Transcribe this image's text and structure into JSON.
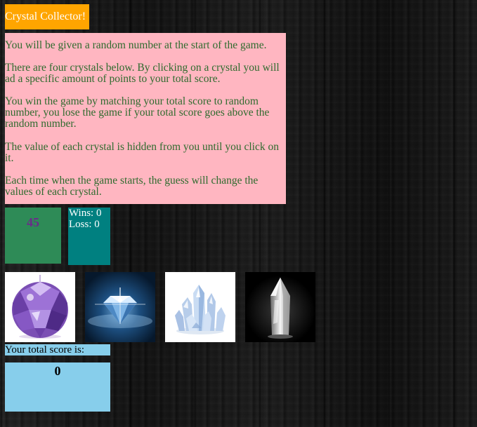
{
  "title": "Crystal Collector!",
  "instructions": [
    "You will be given a random number at the start of the game.",
    "There are four crystals below. By clicking on a crystal you will ad a specific amount of points to your total score.",
    "You win the game by matching your total score to random number, you lose the game if your total score goes above the random number.",
    "The value of each crystal is hidden from you until you click on it.",
    "Each time when the game starts, the guess will change the values of each crystal."
  ],
  "random_number": "45",
  "stats": {
    "wins": "Wins: 0",
    "losses": "Loss: 0"
  },
  "crystals": [
    {
      "icon": "purple-faceted-crystal-icon"
    },
    {
      "icon": "blue-diamond-icon"
    },
    {
      "icon": "blue-crystal-cluster-icon"
    },
    {
      "icon": "clear-quartz-crystal-icon"
    }
  ],
  "score": {
    "label": "Your total score is:",
    "value": "0"
  },
  "colors": {
    "title_bg": "#ffa500",
    "instructions_bg": "#ffb6c1",
    "instructions_text": "#2e6b2e",
    "target_bg": "#2e8b57",
    "target_text": "#6b2b8a",
    "stats_bg": "#008080",
    "score_bg": "#87ceeb"
  }
}
